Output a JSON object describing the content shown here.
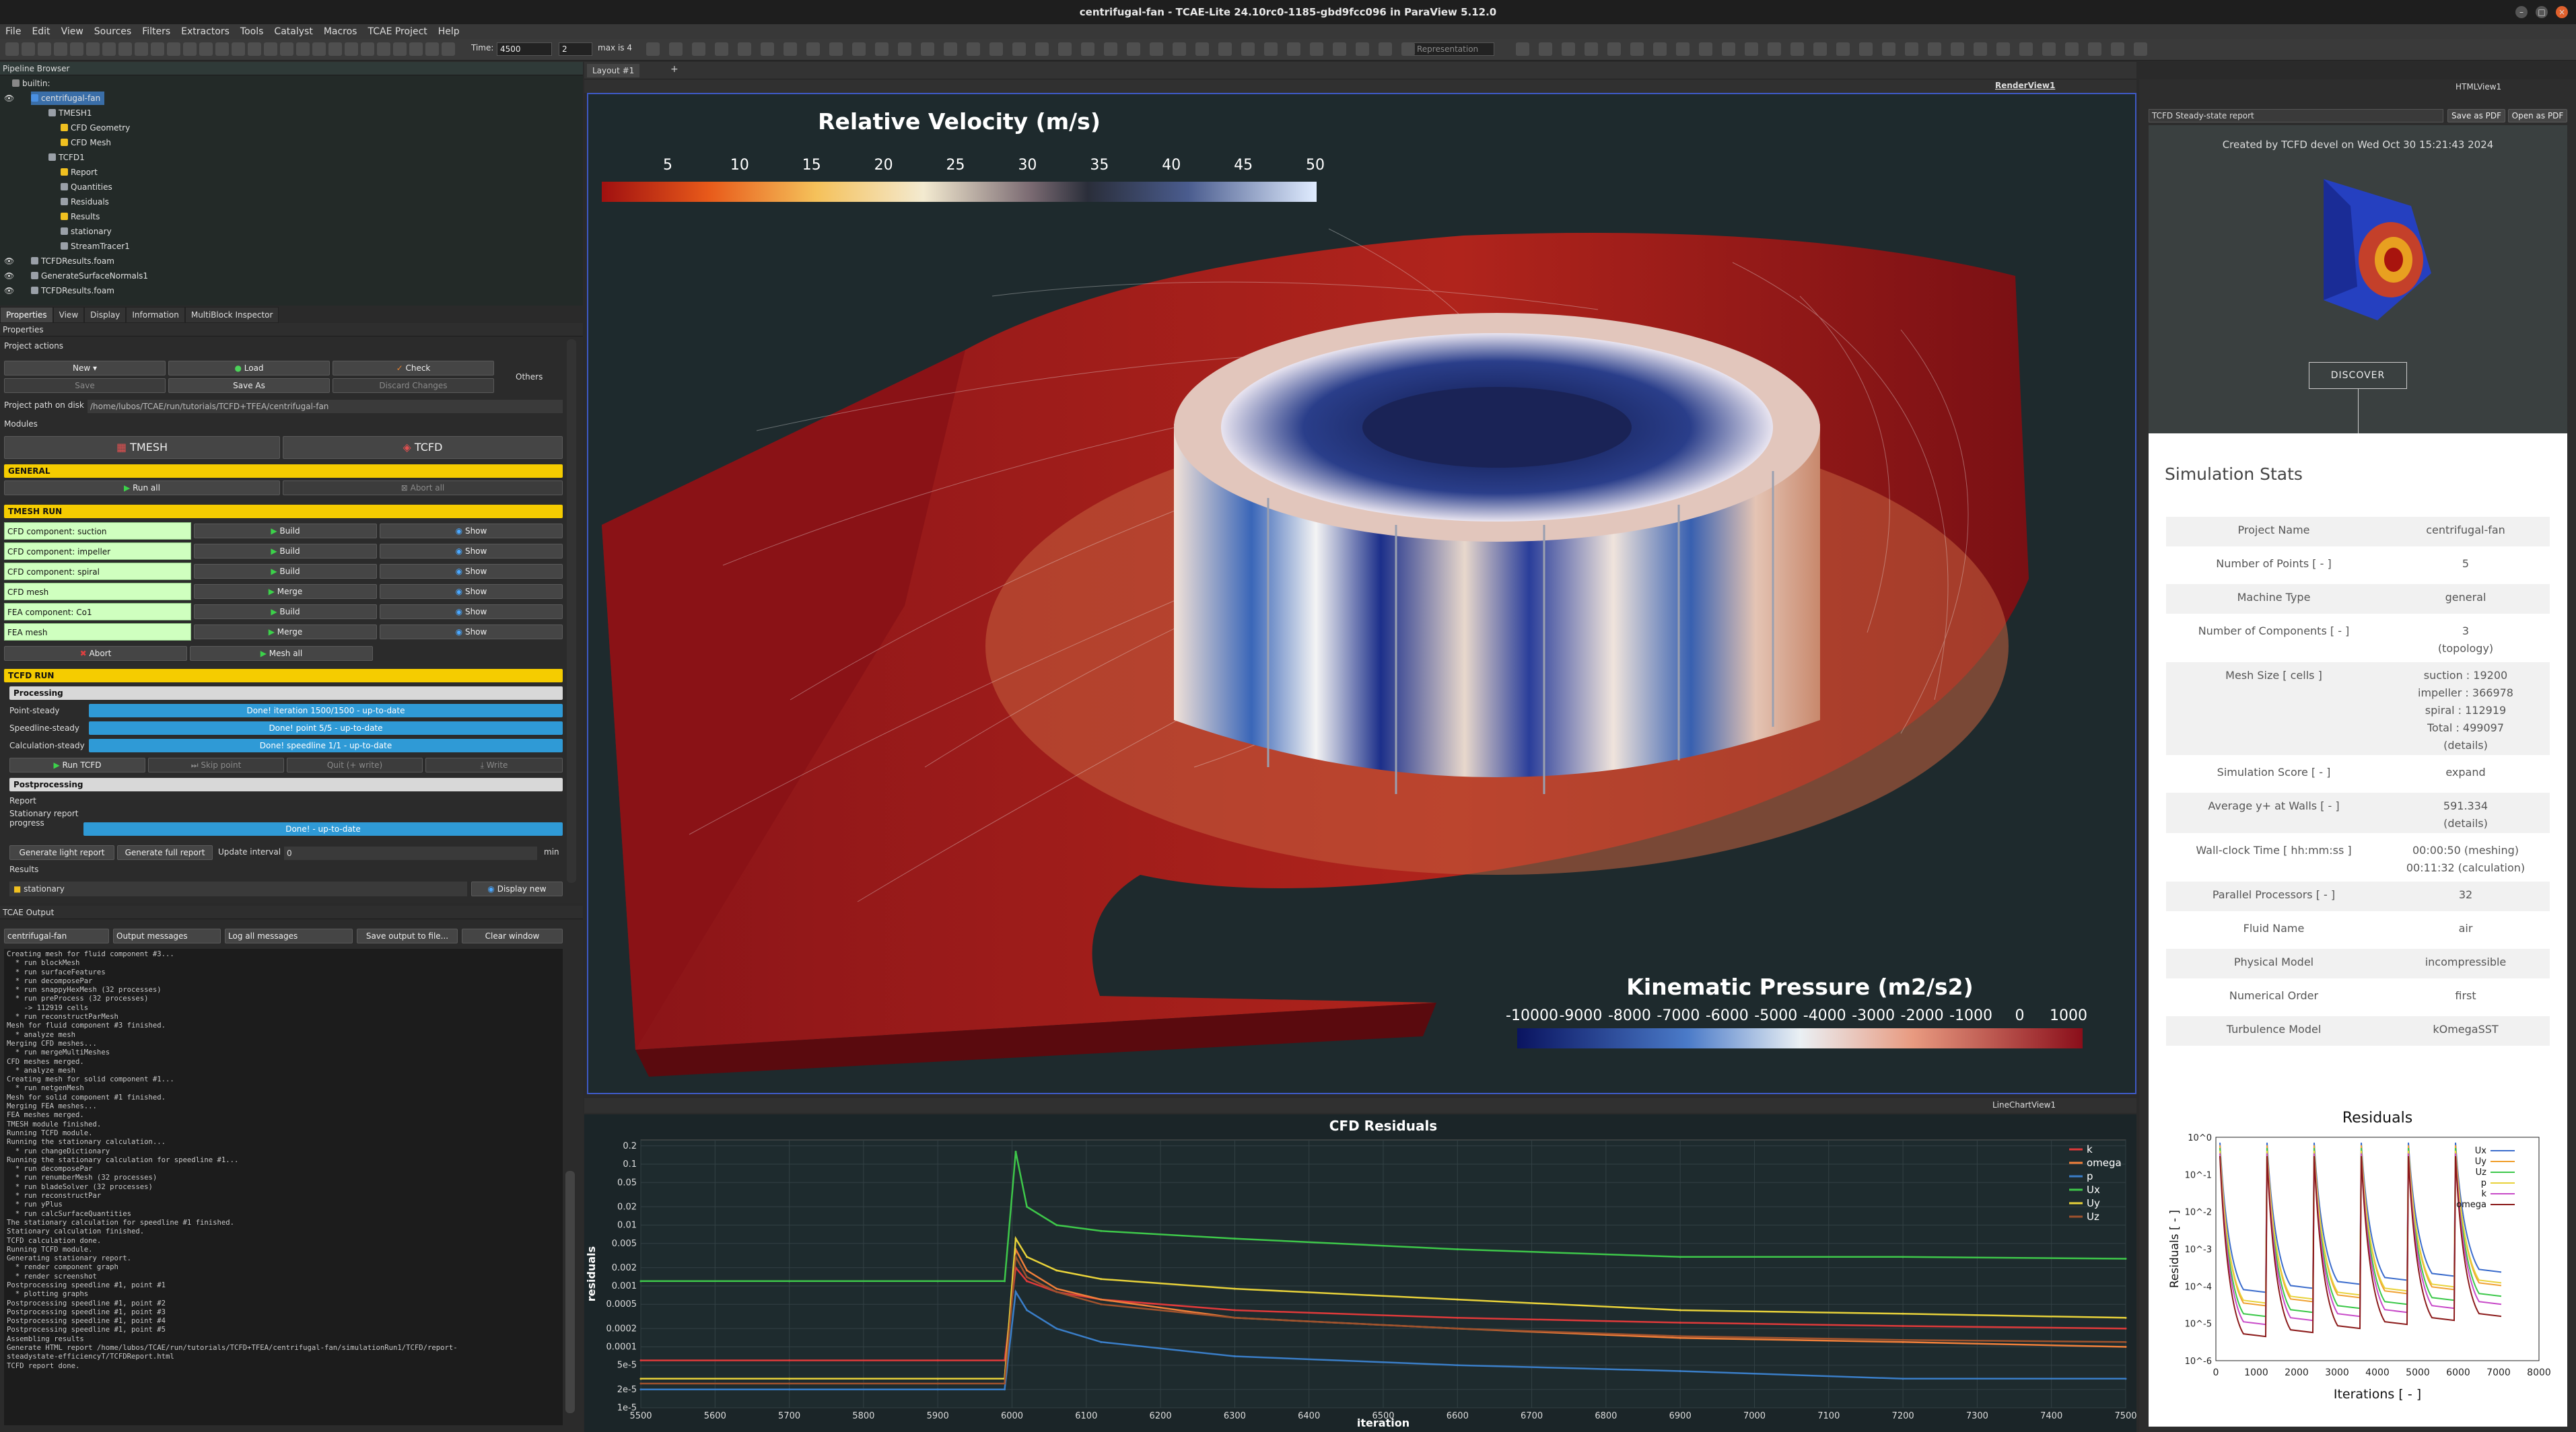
{
  "window": {
    "title": "centrifugal-fan - TCAE-Lite 24.10rc0-1185-gbd9fcc096 in ParaView 5.12.0"
  },
  "menu": [
    "File",
    "Edit",
    "View",
    "Sources",
    "Filters",
    "Extractors",
    "Tools",
    "Catalyst",
    "Macros",
    "TCAE Project",
    "Help"
  ],
  "toolbar": {
    "time_label": "Time:",
    "time_value": "4500",
    "step_value": "2",
    "max_label": "max is 4",
    "representation": "Representation"
  },
  "pipeline": {
    "title": "Pipeline Browser",
    "items": [
      "builtin:",
      "centrifugal-fan",
      "TMESH1",
      "CFD Geometry",
      "CFD Mesh",
      "TCFD1",
      "Report",
      "Quantities",
      "Residuals",
      "Results",
      "stationary",
      "StreamTracer1",
      "TCFDResults.foam",
      "GenerateSurfaceNormals1",
      "TCFDResults.foam"
    ]
  },
  "prop_tabs": [
    "Properties",
    "View",
    "Display",
    "Information",
    "MultiBlock Inspector"
  ],
  "props": {
    "title": "Properties",
    "project_actions": "Project actions",
    "new": "New",
    "load": "Load",
    "check": "Check",
    "save": "Save",
    "save_as": "Save As",
    "discard": "Discard Changes",
    "others": "Others",
    "path_label": "Project path on disk",
    "path": "/home/lubos/TCAE/run/tutorials/TCFD+TFEA/centrifugal-fan",
    "modules": "Modules",
    "tmesh": "TMESH",
    "tcfd": "TCFD",
    "general": "GENERAL",
    "run_all": "Run all",
    "abort_all": "Abort all",
    "tmesh_run": "TMESH RUN",
    "components": [
      {
        "label": "CFD component: suction",
        "action": "Build",
        "show": "Show"
      },
      {
        "label": "CFD component: impeller",
        "action": "Build",
        "show": "Show"
      },
      {
        "label": "CFD component: spiral",
        "action": "Build",
        "show": "Show"
      },
      {
        "label": "CFD mesh",
        "action": "Merge",
        "show": "Show"
      },
      {
        "label": "FEA component: Co1",
        "action": "Build",
        "show": "Show"
      },
      {
        "label": "FEA mesh",
        "action": "Merge",
        "show": "Show"
      }
    ],
    "abort": "Abort",
    "mesh_all": "Mesh all",
    "tcfd_run": "TCFD RUN",
    "processing": "Processing",
    "point_steady": "Point-steady",
    "point_steady_status": "Done! iteration 1500/1500 - up-to-date",
    "speedline_steady": "Speedline-steady",
    "speedline_steady_status": "Done! point 5/5 - up-to-date",
    "calc_steady": "Calculation-steady",
    "calc_steady_status": "Done! speedline 1/1 - up-to-date",
    "run_tcfd": "Run TCFD",
    "skip_point": "Skip point",
    "quit_write": "Quit (+ write)",
    "write": "Write",
    "postprocessing": "Postprocessing",
    "report": "Report",
    "stat_report": "Stationary report",
    "progress_word": "progress",
    "stat_report_status": "Done! - up-to-date",
    "gen_light": "Generate light report",
    "gen_full": "Generate full report",
    "update_interval": "Update interval",
    "interval_value": "0",
    "interval_unit": "min",
    "results": "Results",
    "stationary": "stationary",
    "display_new": "Display new"
  },
  "output": {
    "title": "TCAE Output",
    "combo1": "centrifugal-fan",
    "combo2": "Output messages",
    "combo3": "Log all messages",
    "save": "Save output to file...",
    "clear": "Clear window",
    "lines": [
      "Creating mesh for fluid component #3...",
      "  * run blockMesh",
      "  * run surfaceFeatures",
      "  * run decomposePar",
      "  * run snappyHexMesh (32 processes)",
      "  * run preProcess (32 processes)",
      "    -> 112919 cells",
      "  * run reconstructParMesh",
      "Mesh for fluid component #3 finished.",
      "  * analyze mesh",
      "Merging CFD meshes...",
      "  * run mergeMultiMeshes",
      "CFD meshes merged.",
      "  * analyze mesh",
      "Creating mesh for solid component #1...",
      "  * run netgenMesh",
      "Mesh for solid component #1 finished.",
      "Merging FEA meshes...",
      "FEA meshes merged.",
      "TMESH module finished.",
      "Running TCFD module.",
      "Running the stationary calculation...",
      "  * run changeDictionary",
      "Running the stationary calculation for speedline #1...",
      "  * run decomposePar",
      "  * run renumberMesh (32 processes)",
      "  * run bladeSolver (32 processes)",
      "  * run reconstructPar",
      "  * run yPlus",
      "  * run calcSurfaceQuantities",
      "The stationary calculation for speedline #1 finished.",
      "Stationary calculation finished.",
      "TCFD calculation done.",
      "Running TCFD module.",
      "Generating stationary report.",
      "  * render component graph",
      "  * render screenshot",
      "Postprocessing speedline #1, point #1",
      "  * plotting graphs",
      "Postprocessing speedline #1, point #2",
      "Postprocessing speedline #1, point #3",
      "Postprocessing speedline #1, point #4",
      "Postprocessing speedline #1, point #5",
      "Assembling results",
      "Generate HTML report /home/lubos/TCAE/run/tutorials/TCFD+TFEA/centrifugal-fan/simulationRun1/TCFD/report-",
      "steadystate-efficiencyT/TCFDReport.html",
      "TCFD report done."
    ]
  },
  "layout_tab": "Layout #1",
  "render_view": {
    "name": "RenderView1"
  },
  "vel_bar": {
    "title": "Relative Velocity (m/s)",
    "ticks": [
      "5",
      "10",
      "15",
      "20",
      "25",
      "30",
      "35",
      "40",
      "45",
      "50"
    ]
  },
  "press_bar": {
    "title": "Kinematic Pressure (m2/s2)",
    "ticks": [
      "-10000",
      "-9000",
      "-8000",
      "-7000",
      "-6000",
      "-5000",
      "-4000",
      "-3000",
      "-2000",
      "-1000",
      "0",
      "1000"
    ]
  },
  "linechart_view": {
    "name": "LineChartView1"
  },
  "chart_data": [
    {
      "type": "line",
      "title": "CFD Residuals",
      "xlabel": "iteration",
      "ylabel": "residuals",
      "xlim": [
        5500,
        7500
      ],
      "yscale": "log",
      "ylim": [
        1e-05,
        0.25
      ],
      "x_ticks": [
        "5500",
        "5600",
        "5700",
        "5800",
        "5900",
        "6000",
        "6100",
        "6200",
        "6300",
        "6400",
        "6500",
        "6600",
        "6700",
        "6800",
        "6900",
        "7000",
        "7100",
        "7200",
        "7300",
        "7400",
        "7500"
      ],
      "y_ticks": [
        "1e-5",
        "2e-5",
        "5e-5",
        "0.0001",
        "0.0002",
        "0.0005",
        "0.001",
        "0.002",
        "0.005",
        "0.01",
        "0.02",
        "0.05",
        "0.1",
        "0.2"
      ],
      "x": [
        5500,
        5700,
        5900,
        5990,
        6005,
        6020,
        6060,
        6120,
        6300,
        6600,
        6900,
        7200,
        7500
      ],
      "series": [
        {
          "name": "k",
          "color": "#e03a3a",
          "values": [
            6e-05,
            6e-05,
            6e-05,
            6e-05,
            0.002,
            0.0012,
            0.0008,
            0.0006,
            0.0004,
            0.0003,
            0.00025,
            0.00022,
            0.0002
          ]
        },
        {
          "name": "omega",
          "color": "#f07f3a",
          "values": [
            3e-05,
            3e-05,
            3e-05,
            3e-05,
            0.004,
            0.0018,
            0.0009,
            0.0006,
            0.0003,
            0.0002,
            0.00014,
            0.00012,
            0.0001
          ]
        },
        {
          "name": "p",
          "color": "#3a7ec8",
          "values": [
            2e-05,
            2e-05,
            2e-05,
            2e-05,
            0.0008,
            0.0004,
            0.0002,
            0.00012,
            7e-05,
            5e-05,
            4e-05,
            3e-05,
            3e-05
          ]
        },
        {
          "name": "Ux",
          "color": "#3ec84a",
          "values": [
            0.0012,
            0.0012,
            0.0012,
            0.0012,
            0.16,
            0.02,
            0.01,
            0.008,
            0.006,
            0.004,
            0.003,
            0.003,
            0.0028
          ]
        },
        {
          "name": "Uy",
          "color": "#e8d23a",
          "values": [
            3e-05,
            3e-05,
            3e-05,
            3e-05,
            0.006,
            0.003,
            0.0018,
            0.0013,
            0.0009,
            0.0006,
            0.0004,
            0.00035,
            0.0003
          ]
        },
        {
          "name": "Uz",
          "color": "#a0522d",
          "values": [
            2.5e-05,
            2.5e-05,
            2.5e-05,
            2.5e-05,
            0.003,
            0.0014,
            0.0008,
            0.0005,
            0.0003,
            0.0002,
            0.00015,
            0.00013,
            0.00012
          ]
        }
      ]
    },
    {
      "type": "line",
      "title": "Residuals",
      "xlabel": "Iterations [ - ]",
      "ylabel": "Residuals [ - ]",
      "yscale": "log",
      "xlim": [
        0,
        8000
      ],
      "ylim": [
        1e-06,
        1
      ],
      "x_ticks": [
        "0",
        "1000",
        "2000",
        "3000",
        "4000",
        "5000",
        "6000",
        "7000",
        "8000"
      ],
      "y_ticks": [
        "10^0",
        "10^-1",
        "10^-2",
        "10^-3",
        "10^-4",
        "10^-5",
        "10^-6"
      ],
      "legend": [
        "Ux",
        "Uy",
        "Uz",
        "p",
        "k",
        "omega"
      ],
      "legend_colors": [
        "#3b6ccc",
        "#f0a030",
        "#3cc84a",
        "#e8d23a",
        "#c84ac8",
        "#8b1a1a"
      ]
    }
  ],
  "html_view": {
    "name": "HTMLView1",
    "report_select": "TCFD Steady-state report",
    "save_pdf": "Save as PDF",
    "open_pdf": "Open as PDF"
  },
  "report": {
    "created": "Created by TCFD devel on Wed Oct 30 15:21:43 2024",
    "discover": "DISCOVER",
    "stats_title": "Simulation Stats",
    "rows": [
      {
        "k": "Project Name",
        "v": "centrifugal-fan"
      },
      {
        "k": "Number of Points [ - ]",
        "v": "5"
      },
      {
        "k": "Machine Type",
        "v": "general"
      },
      {
        "k": "Number of Components [ - ]",
        "v": "3",
        "v2": "(topology)"
      },
      {
        "k": "Mesh Size [ cells ]",
        "v": "suction : 19200",
        "v2": "impeller : 366978",
        "v3": "spiral : 112919",
        "v4": "Total : 499097",
        "v5": "(details)"
      },
      {
        "k": "Simulation Score [ - ]",
        "v": "expand"
      },
      {
        "k": "Average y+ at Walls [ - ]",
        "v": "591.334",
        "v2": "(details)"
      },
      {
        "k": "Wall-clock Time [ hh:mm:ss ]",
        "v": "00:00:50 (meshing)",
        "v2": "00:11:32 (calculation)"
      },
      {
        "k": "Parallel Processors [ - ]",
        "v": "32"
      },
      {
        "k": "Fluid Name",
        "v": "air"
      },
      {
        "k": "Physical Model",
        "v": "incompressible"
      },
      {
        "k": "Numerical Order",
        "v": "first"
      },
      {
        "k": "Turbulence Model",
        "v": "kOmegaSST"
      }
    ]
  }
}
